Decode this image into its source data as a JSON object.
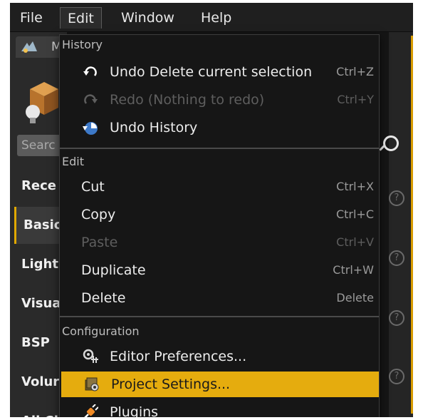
{
  "menubar": {
    "file": "File",
    "edit": "Edit",
    "window": "Window",
    "help": "Help"
  },
  "panel": {
    "tab_label": "M",
    "search_placeholder": "Searc",
    "categories": [
      "Rece",
      "Basic",
      "Light",
      "Visua",
      "BSP",
      "Volur",
      "All Cl"
    ]
  },
  "menu": {
    "history_header": "History",
    "undo": {
      "label": "Undo Delete current selection",
      "shortcut": "Ctrl+Z"
    },
    "redo": {
      "label": "Redo (Nothing to redo)",
      "shortcut": "Ctrl+Y"
    },
    "undo_history": {
      "label": "Undo History"
    },
    "edit_header": "Edit",
    "cut": {
      "label": "Cut",
      "shortcut": "Ctrl+X"
    },
    "copy": {
      "label": "Copy",
      "shortcut": "Ctrl+C"
    },
    "paste": {
      "label": "Paste",
      "shortcut": "Ctrl+V"
    },
    "duplicate": {
      "label": "Duplicate",
      "shortcut": "Ctrl+W"
    },
    "delete": {
      "label": "Delete",
      "shortcut": "Delete"
    },
    "config_header": "Configuration",
    "editor_prefs": {
      "label": "Editor Preferences..."
    },
    "project_settings": {
      "label": "Project Settings..."
    },
    "plugins": {
      "label": "Plugins"
    }
  },
  "colors": {
    "highlight": "#e5ac0e",
    "selected_category_accent": "#e0a800",
    "menu_background": "#161616"
  }
}
